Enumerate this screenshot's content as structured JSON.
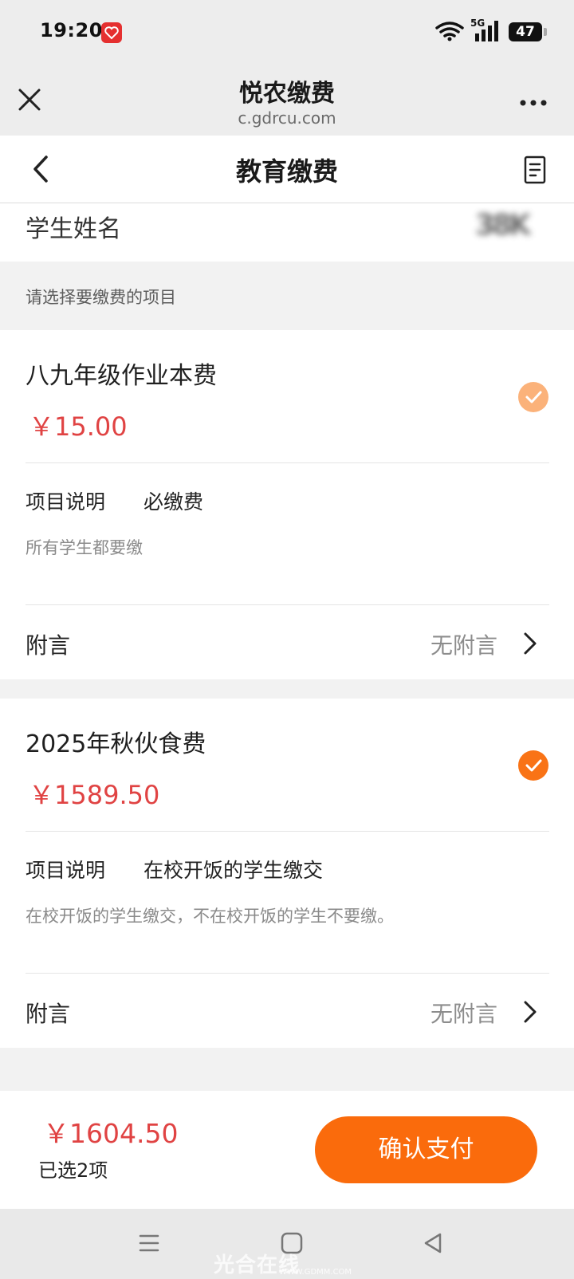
{
  "status_bar": {
    "time": "19:20",
    "network": "5G",
    "battery": "47"
  },
  "mini_program": {
    "title": "悦农缴费",
    "url": "c.gdrcu.com"
  },
  "page": {
    "title": "教育缴费"
  },
  "student": {
    "label": "学生姓名",
    "name": "38K"
  },
  "select_hint": "请选择要缴费的项目",
  "items": [
    {
      "name": "八九年级作业本费",
      "price": "￥15.00",
      "desc_label": "项目说明",
      "desc_value": "必缴费",
      "desc_note": "所有学生都要缴",
      "note_label": "附言",
      "note_value": "无附言",
      "checked_color": "#fbb27a"
    },
    {
      "name": "2025年秋伙食费",
      "price": "￥1589.50",
      "desc_label": "项目说明",
      "desc_value": "在校开饭的学生缴交",
      "desc_note": "在校开饭的学生缴交，不在校开饭的学生不要缴。",
      "note_label": "附言",
      "note_value": "无附言",
      "checked_color": "#f97316"
    }
  ],
  "summary": {
    "total": "￥1604.50",
    "selected": "已选2项",
    "pay_label": "确认支付"
  },
  "watermark": {
    "text": "光合在线",
    "sub": "WWW.GDMM.COM"
  },
  "colors": {
    "accent": "#fa6b0c",
    "price": "#e04343"
  }
}
